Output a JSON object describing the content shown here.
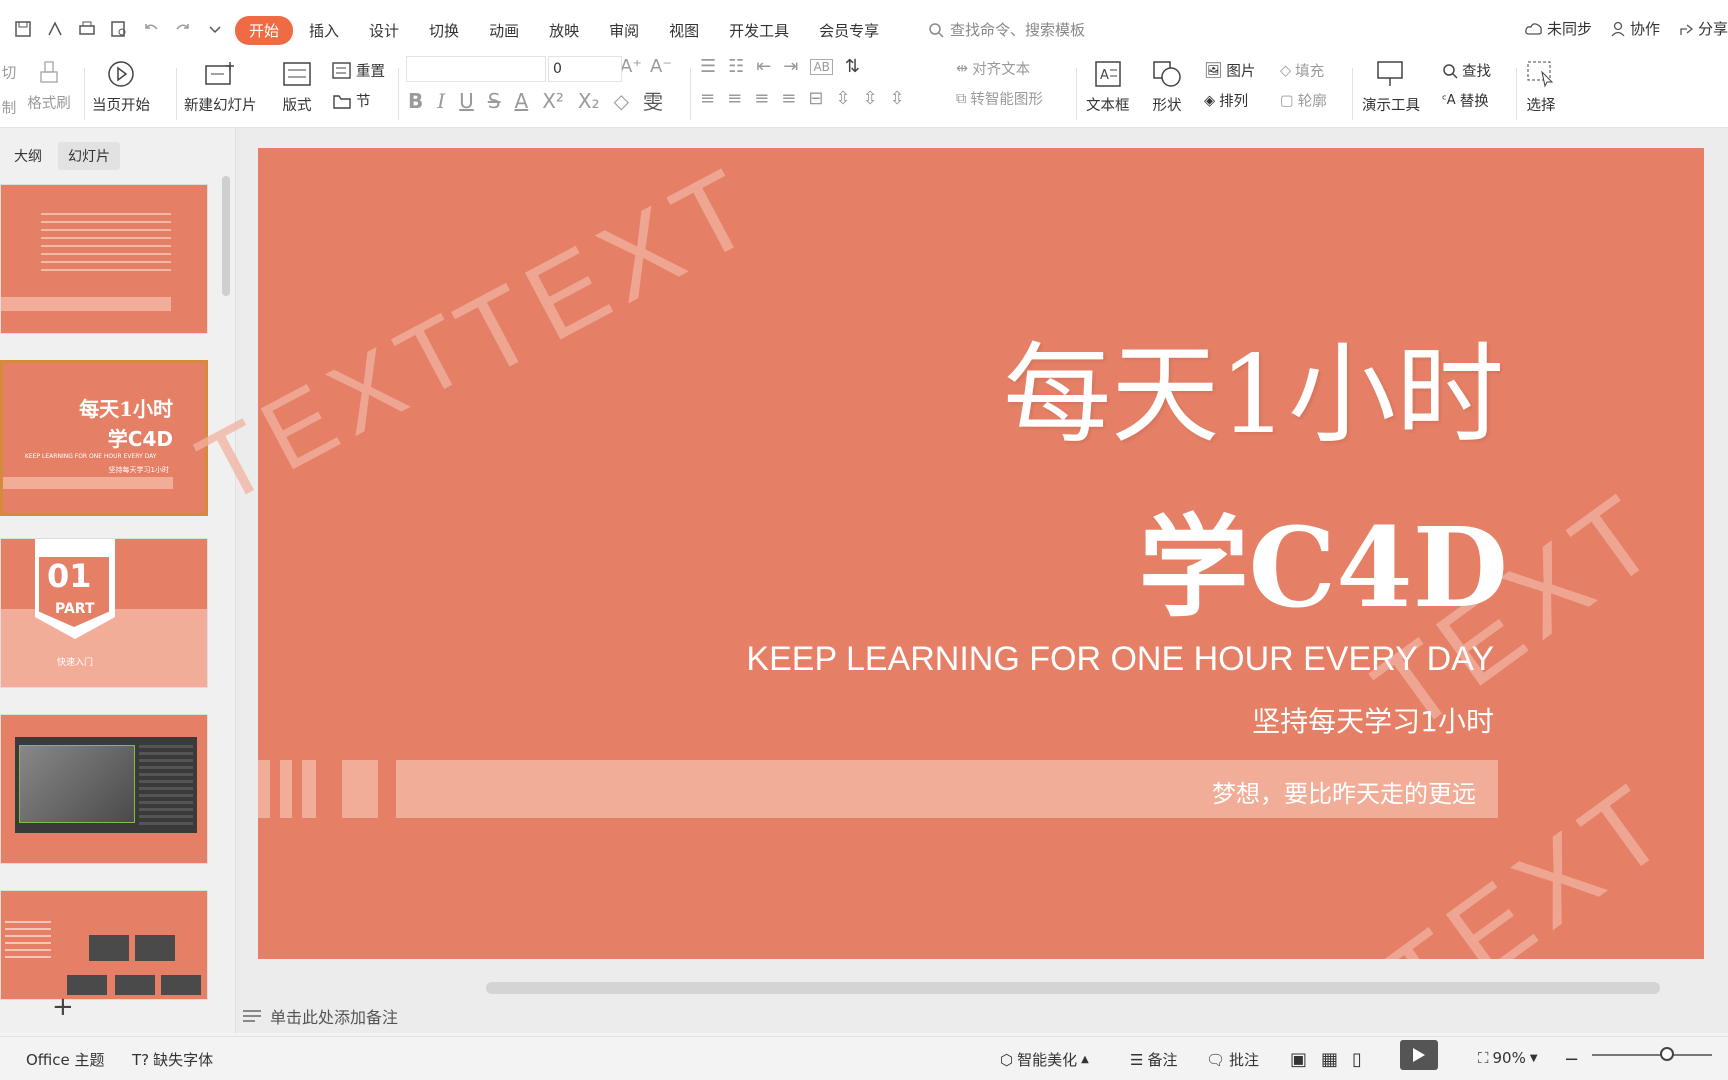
{
  "menu": {
    "items": [
      "开始",
      "插入",
      "设计",
      "切换",
      "动画",
      "放映",
      "审阅",
      "视图",
      "开发工具",
      "会员专享"
    ],
    "active": "开始",
    "search_placeholder": "查找命令、搜索模板"
  },
  "top_actions": {
    "sync": "未同步",
    "collab": "协作",
    "share": "分享"
  },
  "ribbon": {
    "cut": "切",
    "copy": "制",
    "format_painter": "格式刷",
    "start_from_current": "当页开始",
    "new_slide": "新建幻灯片",
    "layout": "版式",
    "reset": "重置",
    "section": "节",
    "font_size": "0",
    "align_text": "对齐文本",
    "smart_shape": "转智能图形",
    "textbox": "文本框",
    "shape": "形状",
    "picture": "图片",
    "fill": "填充",
    "arrange": "排列",
    "outline": "轮廓",
    "present_tools": "演示工具",
    "find": "查找",
    "replace": "替换",
    "select": "选择"
  },
  "panel": {
    "tabs": [
      "大纲",
      "幻灯片"
    ],
    "active_tab": "幻灯片",
    "thumb2": {
      "title1": "每天1小时",
      "title2": "学C4D",
      "en": "KEEP LEARNING FOR ONE HOUR EVERY DAY",
      "cn": "坚持每天学习1小时"
    },
    "thumb3": {
      "num": "01",
      "part": "PART",
      "label": "快速入门"
    }
  },
  "slide": {
    "title_line1": "每天1小时",
    "title_line2": "学C4D",
    "subtitle_en": "KEEP LEARNING FOR ONE HOUR EVERY DAY",
    "subtitle_cn": "坚持每天学习1小时",
    "bar_text": "梦想，要比昨天走的更远",
    "watermark": "TEXT",
    "bg_color": "#e57f65",
    "bar_color": "#f1ad98"
  },
  "notes_placeholder": "单击此处添加备注",
  "status": {
    "theme": "Office 主题",
    "missing_font": "缺失字体",
    "beautify": "智能美化",
    "notes": "备注",
    "comments": "批注",
    "zoom": "90%"
  },
  "colors": {
    "accent": "#f06b44",
    "slide": "#e57f65",
    "bar": "#f1ad98"
  }
}
